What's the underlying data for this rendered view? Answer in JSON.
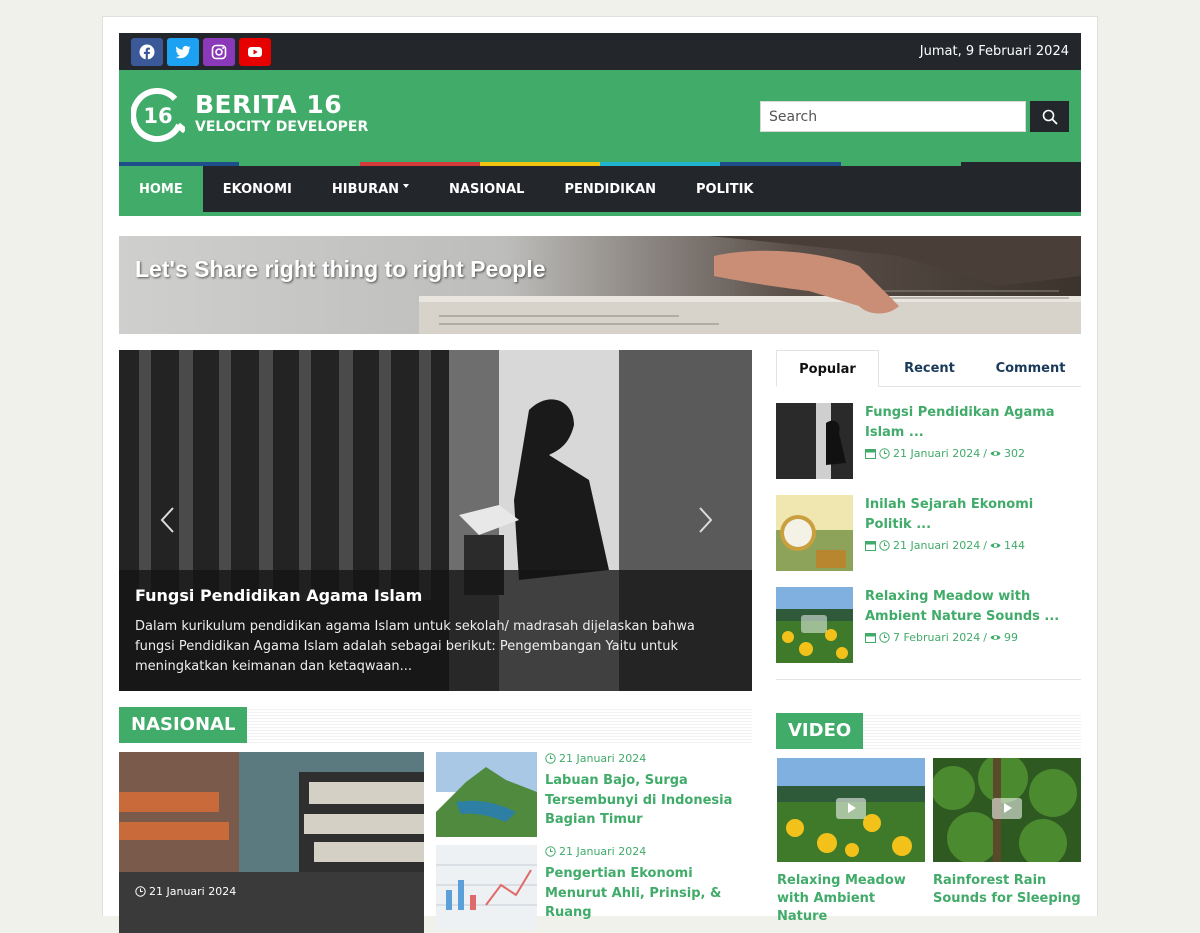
{
  "topbar": {
    "socials": [
      {
        "icon": "facebook-icon",
        "color": "#3b5998"
      },
      {
        "icon": "twitter-icon",
        "color": "#1da1f2"
      },
      {
        "icon": "instagram-icon",
        "color": "#8a3ab9"
      },
      {
        "icon": "youtube-icon",
        "color": "#e60000"
      }
    ],
    "date": "Jumat, 9 Februari 2024"
  },
  "header": {
    "logo_number": "16",
    "logo_title": "BERITA 16",
    "logo_subtitle": "VELOCITY DEVELOPER",
    "search_placeholder": "Search"
  },
  "colors": {
    "accent": "#41ab6a",
    "dark": "#23262b",
    "strip": [
      "#1f4f8a",
      "#41ab6a",
      "#d33b3b",
      "#f1c40f",
      "#1fb5d1",
      "#1f4f8a",
      "#41ab6a",
      "#23262b"
    ]
  },
  "nav": {
    "items": [
      "HOME",
      "EKONOMI",
      "HIBURAN",
      "NASIONAL",
      "PENDIDIKAN",
      "POLITIK"
    ]
  },
  "banner": {
    "text": "Let's Share right thing to right People"
  },
  "slider": {
    "title": "Fungsi Pendidikan Agama Islam",
    "excerpt": "Dalam kurikulum pendidikan agama Islam untuk sekolah/ madrasah dijelaskan bahwa fungsi Pendidikan Agama Islam adalah  sebagai berikut: Pengembangan Yaitu untuk meningkatkan keimanan dan ketaqwaan..."
  },
  "sidebar": {
    "tabs": [
      "Popular",
      "Recent",
      "Comment"
    ],
    "posts": [
      {
        "title": "Fungsi Pendidikan Agama Islam ...",
        "date": "21 Januari 2024",
        "views": "302"
      },
      {
        "title": "Inilah Sejarah Ekonomi Politik ...",
        "date": "21 Januari 2024",
        "views": "144"
      },
      {
        "title": "Relaxing Meadow with Ambient Nature Sounds ...",
        "date": "7 Februari 2024",
        "views": "99"
      }
    ]
  },
  "nasional": {
    "label": "NASIONAL",
    "big_date": "21 Januari 2024",
    "items": [
      {
        "date": "21 Januari 2024",
        "title": "Labuan Bajo, Surga Tersembunyi di Indonesia Bagian Timur"
      },
      {
        "date": "21 Januari 2024",
        "title": "Pengertian Ekonomi Menurut Ahli, Prinsip, & Ruang"
      }
    ]
  },
  "video": {
    "label": "VIDEO",
    "items": [
      {
        "title": "Relaxing Meadow with Ambient Nature"
      },
      {
        "title": "Rainforest Rain Sounds for Sleeping"
      }
    ]
  }
}
